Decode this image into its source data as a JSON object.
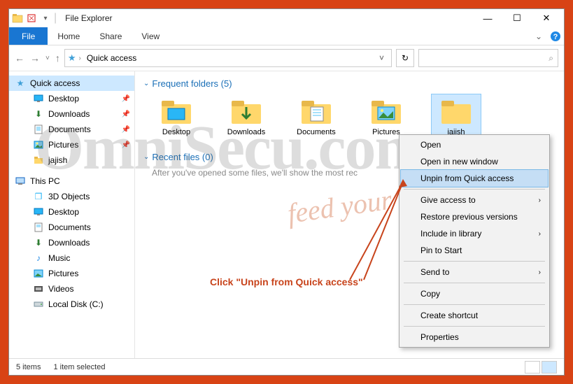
{
  "titlebar": {
    "title": "File Explorer"
  },
  "ribbon": {
    "file": "File",
    "home": "Home",
    "share": "Share",
    "view": "View"
  },
  "address": {
    "crumb": "Quick access"
  },
  "search": {
    "placeholder": ""
  },
  "sidebar": {
    "quick_access": "Quick access",
    "items": [
      {
        "label": "Desktop",
        "pinned": true
      },
      {
        "label": "Downloads",
        "pinned": true
      },
      {
        "label": "Documents",
        "pinned": true
      },
      {
        "label": "Pictures",
        "pinned": true
      },
      {
        "label": "jajish",
        "pinned": false
      }
    ],
    "this_pc": "This PC",
    "pc_items": [
      {
        "label": "3D Objects"
      },
      {
        "label": "Desktop"
      },
      {
        "label": "Documents"
      },
      {
        "label": "Downloads"
      },
      {
        "label": "Music"
      },
      {
        "label": "Pictures"
      },
      {
        "label": "Videos"
      },
      {
        "label": "Local Disk (C:)"
      }
    ]
  },
  "content": {
    "frequent_header": "Frequent folders (5)",
    "recent_header": "Recent files (0)",
    "folders": [
      {
        "label": "Desktop"
      },
      {
        "label": "Downloads"
      },
      {
        "label": "Documents"
      },
      {
        "label": "Pictures"
      },
      {
        "label": "jajish"
      }
    ],
    "recent_empty": "After you've opened some files, we'll show the most rec"
  },
  "context_menu": {
    "items": [
      "Open",
      "Open in new window",
      "Unpin from Quick access",
      "Give access to",
      "Restore previous versions",
      "Include in library",
      "Pin to Start",
      "Send to",
      "Copy",
      "Create shortcut",
      "Properties"
    ]
  },
  "statusbar": {
    "count": "5 items",
    "selected": "1 item selected"
  },
  "annotation": {
    "text": "Click \"Unpin from Quick access\""
  },
  "watermark": {
    "main": "OmniSecu.com",
    "sub": "feed your brain"
  }
}
